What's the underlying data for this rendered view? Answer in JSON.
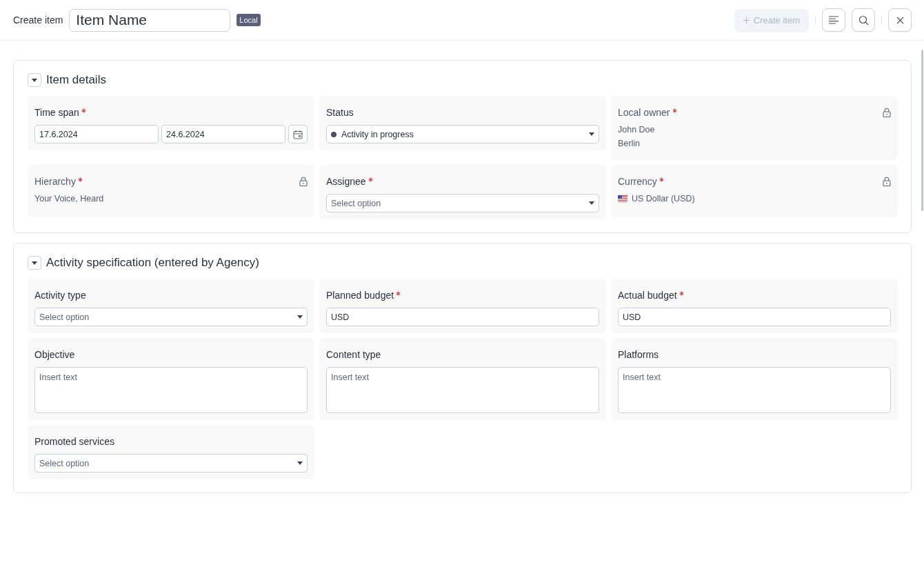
{
  "header": {
    "title": "Create item",
    "name_value": "Item Name",
    "badge": "Local",
    "create_button": {
      "label": "Create item",
      "disabled": true
    }
  },
  "sections": [
    {
      "title": "Item details",
      "expanded": true,
      "fields": [
        {
          "kind": "dates",
          "label": "Time span",
          "required": true,
          "values": [
            "17.6.2024",
            "24.6.2024"
          ]
        },
        {
          "kind": "select",
          "label": "Status",
          "required": false,
          "value": "Activity in progress",
          "color": "#4b5064"
        },
        {
          "kind": "locked",
          "label": "Local owner",
          "required": true,
          "lines": [
            "John Doe",
            "Berlin"
          ]
        },
        {
          "kind": "locked",
          "label": "Hierarchy",
          "required": true,
          "lines": [
            "Your Voice, Heard"
          ]
        },
        {
          "kind": "select",
          "label": "Assignee",
          "required": true,
          "placeholder": "Select option"
        },
        {
          "kind": "locked",
          "label": "Currency",
          "required": true,
          "lines": [
            "US Dollar (USD)"
          ],
          "flag": true
        }
      ]
    },
    {
      "title": "Activity specification (entered by Agency)",
      "expanded": true,
      "fields": [
        {
          "kind": "select",
          "label": "Activity type",
          "required": false,
          "placeholder": "Select option"
        },
        {
          "kind": "input",
          "label": "Planned budget",
          "required": true,
          "value": "USD"
        },
        {
          "kind": "input",
          "label": "Actual budget",
          "required": true,
          "value": "USD"
        },
        {
          "kind": "textarea",
          "label": "Objective",
          "required": false,
          "placeholder": "Insert text"
        },
        {
          "kind": "textarea",
          "label": "Content type",
          "required": false,
          "placeholder": "Insert text"
        },
        {
          "kind": "textarea",
          "label": "Platforms",
          "required": false,
          "placeholder": "Insert text"
        },
        {
          "kind": "select",
          "label": "Promoted services",
          "required": false,
          "placeholder": "Select option"
        }
      ]
    }
  ]
}
